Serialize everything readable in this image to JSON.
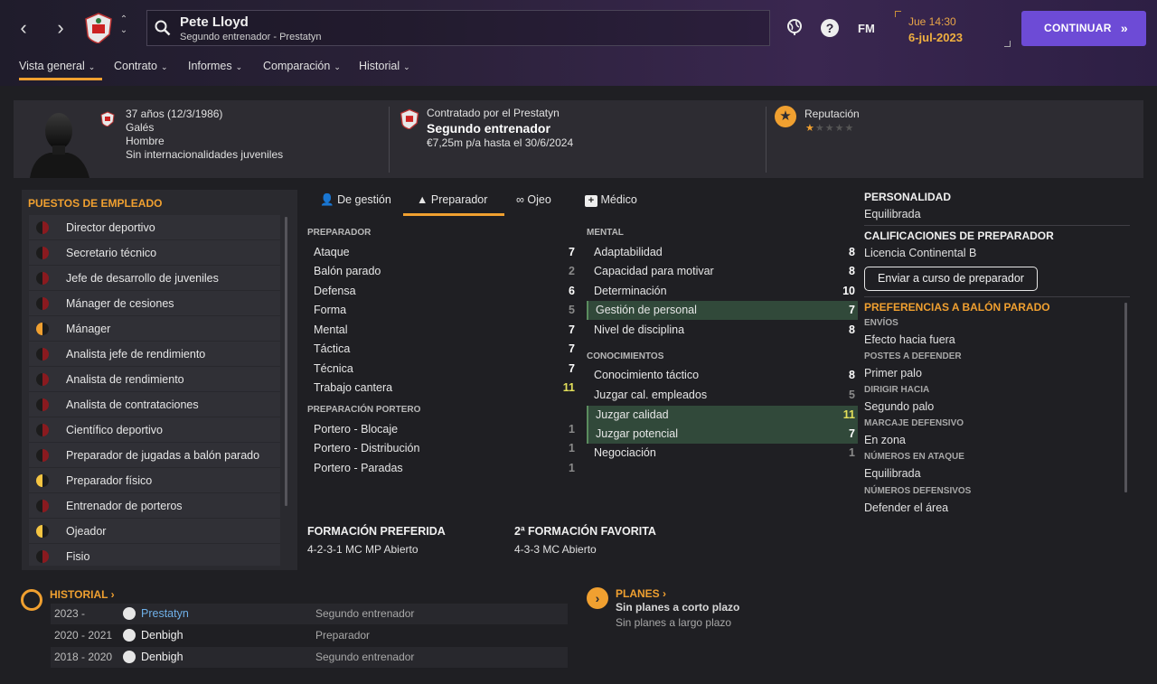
{
  "header": {
    "name": "Pete Lloyd",
    "subtitle": "Segundo entrenador - Prestatyn",
    "fm_label": "FM",
    "date_line1": "Jue 14:30",
    "date_line2": "6-jul-2023",
    "continue_label": "CONTINUAR"
  },
  "tabs": [
    {
      "label": "Vista general"
    },
    {
      "label": "Contrato"
    },
    {
      "label": "Informes"
    },
    {
      "label": "Comparación"
    },
    {
      "label": "Historial"
    }
  ],
  "profile": {
    "age": "37 años (12/3/1986)",
    "nationality": "Galés",
    "gender": "Hombre",
    "caps": "Sin internacionalidades juveniles",
    "contract_by": "Contratado por el Prestatyn",
    "role": "Segundo entrenador",
    "salary": "€7,25m p/a hasta el 30/6/2024",
    "reputation_label": "Reputación",
    "reputation_stars": 0.5,
    "reputation_max": 5
  },
  "staff_positions": {
    "title": "PUESTOS DE EMPLEADO",
    "items": [
      {
        "label": "Director deportivo",
        "level": "red"
      },
      {
        "label": "Secretario técnico",
        "level": "red"
      },
      {
        "label": "Jefe de desarrollo de juveniles",
        "level": "red"
      },
      {
        "label": "Mánager de cesiones",
        "level": "red"
      },
      {
        "label": "Mánager",
        "level": "orange"
      },
      {
        "label": "Analista jefe de rendimiento",
        "level": "red"
      },
      {
        "label": "Analista de rendimiento",
        "level": "red"
      },
      {
        "label": "Analista de contrataciones",
        "level": "red"
      },
      {
        "label": "Científico deportivo",
        "level": "red"
      },
      {
        "label": "Preparador de jugadas a balón parado",
        "level": "red"
      },
      {
        "label": "Preparador físico",
        "level": "yellow"
      },
      {
        "label": "Entrenador de porteros",
        "level": "red"
      },
      {
        "label": "Ojeador",
        "level": "yellow"
      },
      {
        "label": "Fisio",
        "level": "red"
      }
    ]
  },
  "subtabs": [
    {
      "label": "De gestión"
    },
    {
      "label": "Preparador"
    },
    {
      "label": "Ojeo"
    },
    {
      "label": "Médico"
    }
  ],
  "attributes": {
    "coaching_title": "PREPARADOR",
    "coaching": [
      {
        "name": "Ataque",
        "value": "7"
      },
      {
        "name": "Balón parado",
        "value": "2"
      },
      {
        "name": "Defensa",
        "value": "6"
      },
      {
        "name": "Forma",
        "value": "5"
      },
      {
        "name": "Mental",
        "value": "7"
      },
      {
        "name": "Táctica",
        "value": "7"
      },
      {
        "name": "Técnica",
        "value": "7"
      },
      {
        "name": "Trabajo cantera",
        "value": "11"
      }
    ],
    "gk_title": "PREPARACIÓN PORTERO",
    "gk": [
      {
        "name": "Portero - Blocaje",
        "value": "1"
      },
      {
        "name": "Portero - Distribución",
        "value": "1"
      },
      {
        "name": "Portero - Paradas",
        "value": "1"
      }
    ],
    "mental_title": "MENTAL",
    "mental": [
      {
        "name": "Adaptabilidad",
        "value": "8"
      },
      {
        "name": "Capacidad para motivar",
        "value": "8"
      },
      {
        "name": "Determinación",
        "value": "10"
      },
      {
        "name": "Gestión de personal",
        "value": "7"
      },
      {
        "name": "Nivel de disciplina",
        "value": "8"
      }
    ],
    "knowledge_title": "CONOCIMIENTOS",
    "knowledge": [
      {
        "name": "Conocimiento táctico",
        "value": "8"
      },
      {
        "name": "Juzgar cal. empleados",
        "value": "5"
      },
      {
        "name": "Juzgar calidad",
        "value": "11"
      },
      {
        "name": "Juzgar potencial",
        "value": "7"
      },
      {
        "name": "Negociación",
        "value": "1"
      }
    ]
  },
  "formations": {
    "preferred_label": "FORMACIÓN PREFERIDA",
    "preferred_value": "4-2-3-1 MC MP Abierto",
    "second_label": "2ª FORMACIÓN FAVORITA",
    "second_value": "4-3-3 MC Abierto"
  },
  "right": {
    "personality_title": "PERSONALIDAD",
    "personality": "Equilibrada",
    "qual_title": "CALIFICACIONES DE PREPARADOR",
    "qual": "Licencia Continental B",
    "course_button": "Enviar a curso de preparador",
    "setpiece_title": "PREFERENCIAS A BALÓN PARADO",
    "prefs": [
      {
        "label": "ENVÍOS",
        "value": "Efecto hacia fuera"
      },
      {
        "label": "POSTES A DEFENDER",
        "value": "Primer palo"
      },
      {
        "label": "DIRIGIR HACIA",
        "value": "Segundo palo"
      },
      {
        "label": "MARCAJE DEFENSIVO",
        "value": "En zona"
      },
      {
        "label": "NÚMEROS EN ATAQUE",
        "value": "Equilibrada"
      },
      {
        "label": "NÚMEROS DEFENSIVOS",
        "value": "Defender el área"
      }
    ]
  },
  "history": {
    "title": "HISTORIAL",
    "rows": [
      {
        "years": "2023 -",
        "club": "Prestatyn",
        "role": "Segundo entrenador"
      },
      {
        "years": "2020 - 2021",
        "club": "Denbigh",
        "role": "Preparador"
      },
      {
        "years": "2018 - 2020",
        "club": "Denbigh",
        "role": "Segundo entrenador"
      }
    ]
  },
  "plans": {
    "title": "PLANES",
    "short": "Sin planes a corto plazo",
    "long": "Sin planes a largo plazo"
  },
  "colors": {
    "accent": "#f0a030",
    "continue": "#6d4bd6",
    "highlight_row": "#31493a",
    "link": "#6fb0e8"
  }
}
